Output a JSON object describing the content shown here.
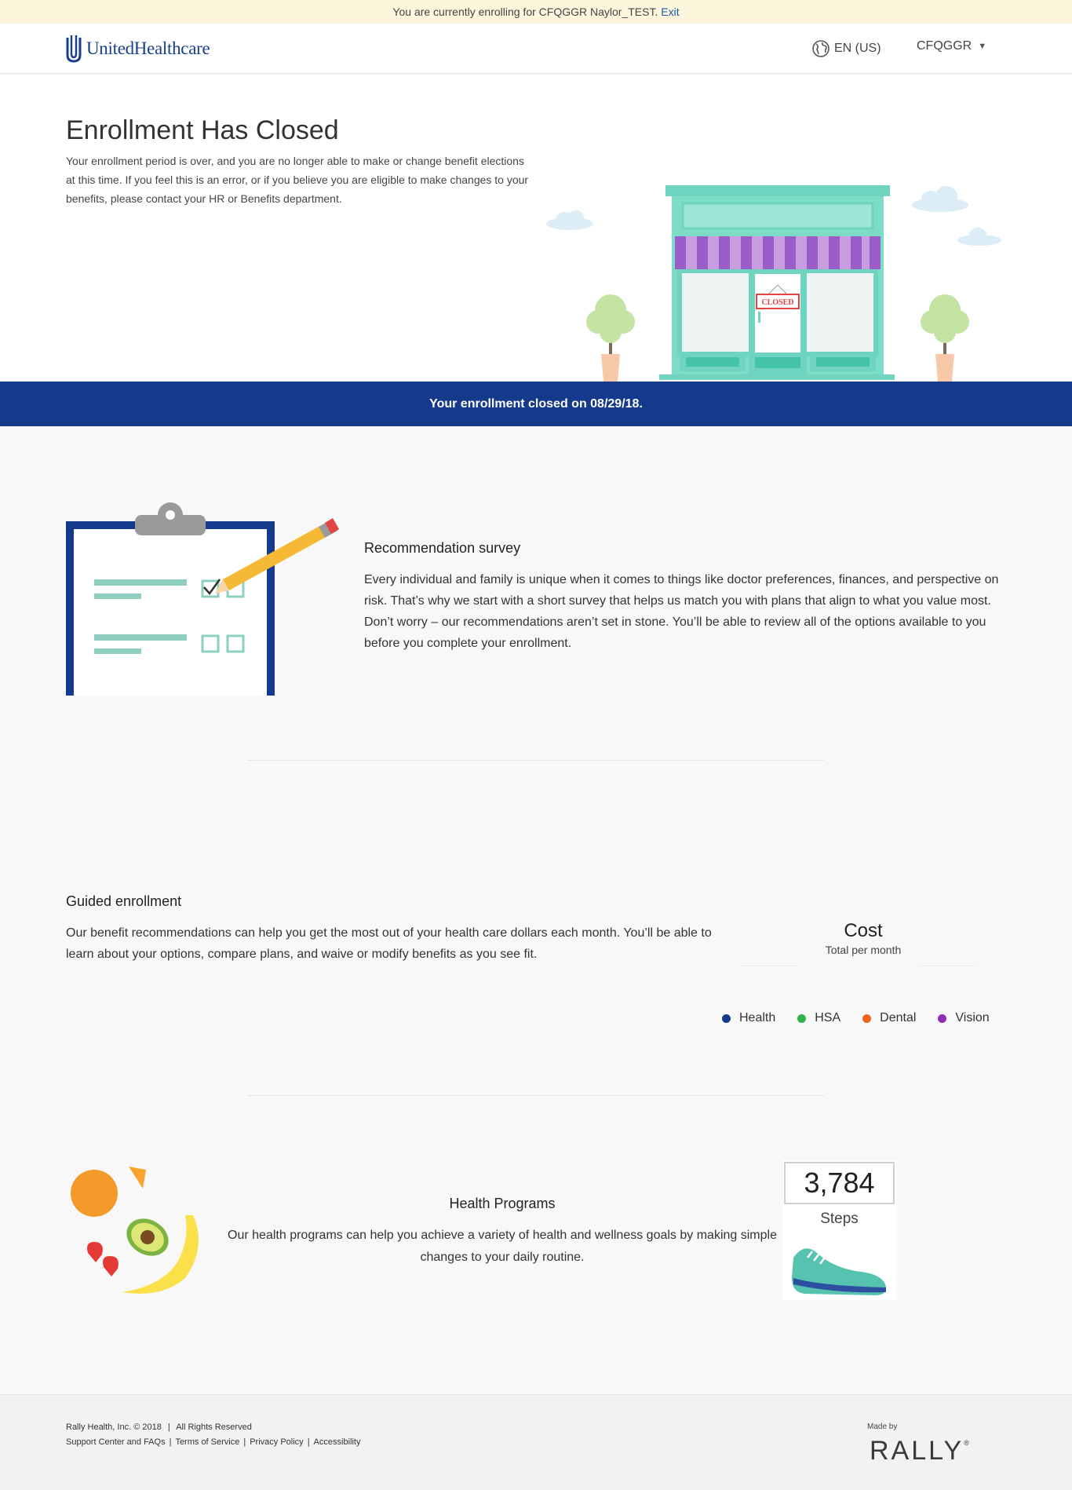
{
  "banner": {
    "text": "You are currently enrolling for CFQGGR Naylor_TEST.",
    "exit_label": "Exit"
  },
  "header": {
    "logo_text": "UnitedHealthcare",
    "language": "EN (US)",
    "user": "CFQGGR"
  },
  "hero": {
    "title": "Enrollment Has Closed",
    "body": "Your enrollment period is over, and you are no longer able to make or change benefit elections at this time. If you feel this is an error, or if you believe you are eligible to make changes to your benefits, please contact your HR or Benefits department.",
    "sign_text": "CLOSED"
  },
  "closed_bar": {
    "text": "Your enrollment closed on 08/29/18."
  },
  "survey": {
    "title": "Recommendation survey",
    "body": "Every individual and family is unique when it comes to things like doctor preferences, finances, and perspective on risk. That’s why we start with a short survey that helps us match you with plans that align to what you value most. Don’t worry – our recommendations aren’t set in stone. You’ll be able to review all of the options available to you before you complete your enrollment."
  },
  "guided": {
    "title": "Guided enrollment",
    "body": "Our benefit recommendations can help you get the most out of your health care dollars each month. You’ll be able to learn about your options, compare plans, and waive or modify benefits as you see fit.",
    "cost_title": "Cost",
    "cost_subtitle": "Total per month",
    "legend": [
      {
        "label": "Health",
        "color": "#153a8b"
      },
      {
        "label": "HSA",
        "color": "#2fb34a"
      },
      {
        "label": "Dental",
        "color": "#f0641e"
      },
      {
        "label": "Vision",
        "color": "#8f2fb8"
      }
    ]
  },
  "programs": {
    "title": "Health Programs",
    "body": "Our health programs can help you achieve a variety of health and wellness goals by making simple changes to your daily routine.",
    "steps_count": "3,784",
    "steps_label": "Steps"
  },
  "footer": {
    "copyright": "Rally Health, Inc. © 2018",
    "rights": "All Rights Reserved",
    "links": [
      "Support Center and FAQs",
      "Terms of Service",
      "Privacy Policy",
      "Accessibility"
    ],
    "made_by": "Made by",
    "brand": "RALLY"
  }
}
